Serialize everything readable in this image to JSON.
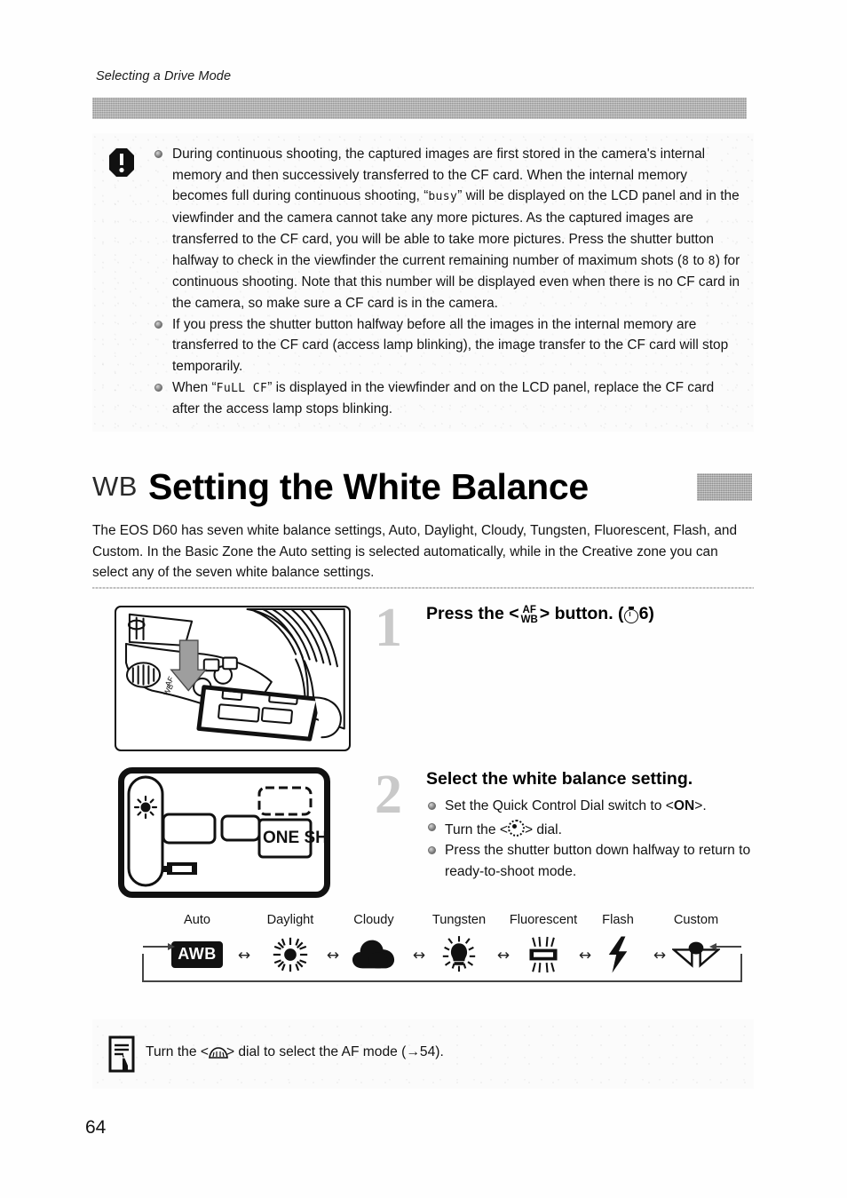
{
  "running_head": "Selecting a Drive Mode",
  "page_number": "64",
  "caution": {
    "icon": "warning-octagon-icon",
    "items": [
      {
        "parts": [
          {
            "t": "During continuous shooting, the captured images are first stored in the camera's internal memory and then successively transferred to the CF card. When the internal memory becomes full during continuous shooting, “"
          },
          {
            "t": "busy",
            "lcd": true
          },
          {
            "t": "” will be displayed on the LCD panel and in the viewfinder and the camera cannot take any more pictures. As the captured images are transferred to the CF card, you will be able to take more pictures. Press the shutter button halfway to check in the viewfinder the current remaining number of maximum shots ("
          },
          {
            "t": "8",
            "lcd": true
          },
          {
            "t": " to "
          },
          {
            "t": "8",
            "lcd": true
          },
          {
            "t": ") for continuous shooting. Note that this number will be displayed even when there is no CF card in the camera, so make sure a CF card is in the camera."
          }
        ]
      },
      {
        "parts": [
          {
            "t": "If you press the shutter button halfway before all the images in the internal memory are transferred to the CF card (access lamp blinking), the image transfer to the CF card will stop temporarily."
          }
        ]
      },
      {
        "parts": [
          {
            "t": "When “"
          },
          {
            "t": "FuLL CF",
            "lcd": true
          },
          {
            "t": "” is displayed in the viewfinder and on the LCD panel, replace the CF card after the access lamp stops blinking."
          }
        ]
      }
    ]
  },
  "heading": {
    "mark": "WB",
    "title": "Setting the White Balance"
  },
  "intro": "The EOS D60 has seven white balance settings, Auto, Daylight, Cloudy, Tungsten, Fluorescent, Flash, and Custom. In the Basic Zone the Auto setting is selected automatically, while in the Creative zone you can select any of the seven white balance settings.",
  "step1": {
    "number": "1",
    "title_before": "Press the <",
    "glyph_top": "AF",
    "glyph_bottom": "WB",
    "title_after": "> button. (",
    "timer_value": "6",
    "title_end": ")",
    "figure": "camera-top-afwb-button-illustration"
  },
  "step2": {
    "number": "2",
    "title": "Select the white balance setting.",
    "bullets": [
      {
        "before": "Set the Quick Control Dial switch to <",
        "bold": "ON",
        "after": ">."
      },
      {
        "before": "Turn the <",
        "dial": true,
        "after": "> dial."
      },
      {
        "before": "Press the shutter button down halfway to return to ready-to-shoot mode.",
        "bold": "",
        "after": ""
      }
    ],
    "figure": "lcd-panel-illustration",
    "lcd_one_shot": "ONE SHOT"
  },
  "wb_flow": {
    "items": [
      {
        "label": "Auto",
        "icon": "awb-box-icon",
        "text": "AWB"
      },
      {
        "label": "Daylight",
        "icon": "sun-icon"
      },
      {
        "label": "Cloudy",
        "icon": "cloud-icon"
      },
      {
        "label": "Tungsten",
        "icon": "tungsten-bulb-icon"
      },
      {
        "label": "Fluorescent",
        "icon": "fluorescent-tube-icon"
      },
      {
        "label": "Flash",
        "icon": "flash-bolt-icon"
      },
      {
        "label": "Custom",
        "icon": "custom-wb-icon"
      }
    ],
    "separator": "↔"
  },
  "note": {
    "icon": "note-pencil-icon",
    "before": "Turn the <",
    "dial_icon": "main-dial-icon",
    "after": "> dial to select the AF mode (→54)."
  },
  "colors": {
    "gray_bar": "#a9a9a9",
    "ink": "#111111",
    "step_number": "#c9c9c9"
  }
}
